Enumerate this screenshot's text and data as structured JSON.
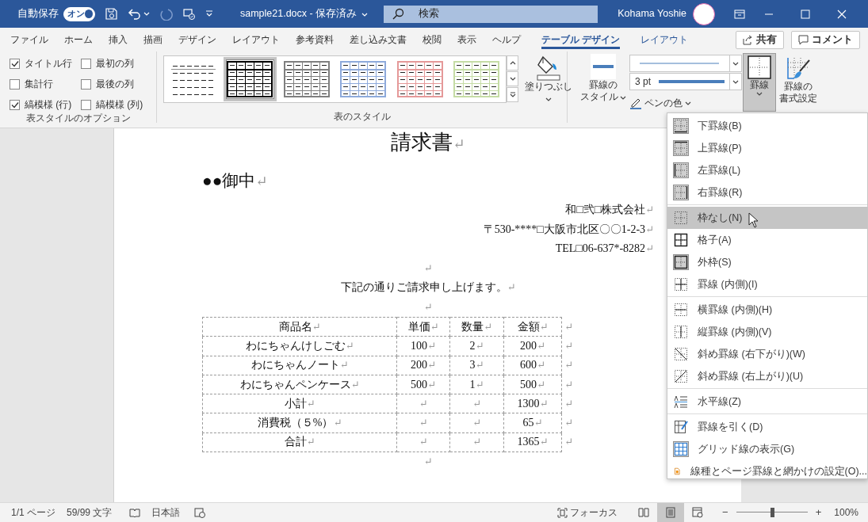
{
  "title_bar": {
    "autosave_label": "自動保存",
    "autosave_toggle": {
      "label": "オン",
      "on": true
    },
    "quick_access": [
      {
        "disabled": false
      },
      {
        "disabled": false
      },
      {
        "disabled": true
      },
      {
        "disabled": false
      }
    ],
    "document_title": "sample21.docx - 保存済み",
    "search": {
      "placeholder": "検索"
    },
    "user_name": "Kohama Yoshie"
  },
  "tabs": [
    {
      "label": "ファイル",
      "selected": false,
      "kind": "standard"
    },
    {
      "label": "ホーム",
      "selected": false,
      "kind": "standard"
    },
    {
      "label": "挿入",
      "selected": false,
      "kind": "standard"
    },
    {
      "label": "描画",
      "selected": false,
      "kind": "standard"
    },
    {
      "label": "デザイン",
      "selected": false,
      "kind": "standard"
    },
    {
      "label": "レイアウト",
      "selected": false,
      "kind": "standard"
    },
    {
      "label": "参考資料",
      "selected": false,
      "kind": "standard"
    },
    {
      "label": "差し込み文書",
      "selected": false,
      "kind": "standard"
    },
    {
      "label": "校閲",
      "selected": false,
      "kind": "standard"
    },
    {
      "label": "表示",
      "selected": false,
      "kind": "standard"
    },
    {
      "label": "ヘルプ",
      "selected": false,
      "kind": "standard"
    },
    {
      "label": "テーブル デザイン",
      "selected": true,
      "kind": "contextual"
    },
    {
      "label": "レイアウト",
      "selected": false,
      "kind": "contextual"
    }
  ],
  "share_button": "共有",
  "comment_button": "コメント",
  "table_style_options": {
    "label": "表スタイルのオプション",
    "checkboxes": [
      {
        "label": "タイトル行",
        "checked": true
      },
      {
        "label": "最初の列",
        "checked": false
      },
      {
        "label": "集計行",
        "checked": false
      },
      {
        "label": "最後の列",
        "checked": false
      },
      {
        "label": "縞模様 (行)",
        "checked": true
      },
      {
        "label": "縞模様 (列)",
        "checked": false
      }
    ]
  },
  "table_styles": {
    "label": "表のスタイル",
    "styles": [
      {
        "kind": "plain",
        "color": "#8c8c8c",
        "selected": false
      },
      {
        "kind": "grid",
        "color": "#000000",
        "selected": true
      },
      {
        "kind": "grid",
        "color": "#7f7f7f",
        "selected": false
      },
      {
        "kind": "grid",
        "color": "#8eaadb",
        "selected": false
      },
      {
        "kind": "grid",
        "color": "#e59999",
        "selected": false
      },
      {
        "kind": "grid",
        "color": "#c5dca5",
        "selected": false
      }
    ],
    "shading_button": "塗りつぶし"
  },
  "borders": {
    "style_button": [
      "罫線の",
      "スタイル"
    ],
    "line_weight": "3 pt",
    "pen_color_button": "ペンの色",
    "borders_button": {
      "label": "罫線",
      "selected": true
    },
    "border_painter_button": [
      "罫線の",
      "書式設定"
    ]
  },
  "document": {
    "paragraphs": [
      {
        "kind": "title",
        "text": "請求書",
        "mark": "↵"
      },
      {
        "kind": "addressee",
        "text": "●●御中",
        "mark": "↵"
      },
      {
        "kind": "sender",
        "text": "和□弐□株式会社",
        "mark": "↵"
      },
      {
        "kind": "sender",
        "text": "〒530-****□大阪市北区〇〇1-2-3",
        "mark": "↵"
      },
      {
        "kind": "sender",
        "text": "TEL□06-637*-8282",
        "mark": "↵"
      },
      {
        "kind": "blank",
        "mark": "↵"
      },
      {
        "kind": "body",
        "text": "下記の通りご請求申し上げます。",
        "mark": "↵"
      },
      {
        "kind": "blank",
        "mark": "↵"
      }
    ],
    "table": {
      "rows": [
        {
          "cells": [
            {
              "text": "商品名",
              "mark": "↵"
            },
            {
              "text": "単価",
              "mark": "↵"
            },
            {
              "text": "数量",
              "mark": "↵"
            },
            {
              "text": "金額",
              "mark": "↵"
            }
          ],
          "end_mark": "↵"
        },
        {
          "cells": [
            {
              "text": "わにちゃんけしごむ",
              "mark": "↵"
            },
            {
              "text": "100",
              "mark": "↵"
            },
            {
              "text": "2",
              "mark": "↵"
            },
            {
              "text": "200",
              "mark": "↵"
            }
          ],
          "end_mark": "↵"
        },
        {
          "cells": [
            {
              "text": "わにちゃんノート",
              "mark": "↵"
            },
            {
              "text": "200",
              "mark": "↵"
            },
            {
              "text": "3",
              "mark": "↵"
            },
            {
              "text": "600",
              "mark": "↵"
            }
          ],
          "end_mark": "↵"
        },
        {
          "cells": [
            {
              "text": "わにちゃんペンケース",
              "mark": "↵"
            },
            {
              "text": "500",
              "mark": "↵"
            },
            {
              "text": "1",
              "mark": "↵"
            },
            {
              "text": "500",
              "mark": "↵"
            }
          ],
          "end_mark": "↵"
        },
        {
          "cells": [
            {
              "text": "小計",
              "mark": "↵"
            },
            {
              "mark": "↵"
            },
            {
              "mark": "↵"
            },
            {
              "text": "1300",
              "mark": "↵"
            }
          ],
          "end_mark": "↵"
        },
        {
          "cells": [
            {
              "text": "消費税（５%）",
              "mark": "↵"
            },
            {
              "mark": "↵"
            },
            {
              "mark": "↵"
            },
            {
              "text": "65",
              "mark": "↵"
            }
          ],
          "end_mark": "↵"
        },
        {
          "cells": [
            {
              "text": "合計",
              "mark": "↵"
            },
            {
              "mark": "↵"
            },
            {
              "mark": "↵"
            },
            {
              "text": "1365",
              "mark": "↵"
            }
          ],
          "end_mark": "↵"
        }
      ]
    },
    "paragraphs_after": [
      {
        "kind": "blank",
        "mark": "↵"
      }
    ]
  },
  "borders_menu": {
    "groups": [
      [
        {
          "label": "下罫線(B)",
          "checked": true,
          "selected": false
        },
        {
          "label": "上罫線(P)",
          "checked": true,
          "selected": false
        },
        {
          "label": "左罫線(L)",
          "checked": true,
          "selected": false
        },
        {
          "label": "右罫線(R)",
          "checked": true,
          "selected": false
        }
      ],
      [
        {
          "label": "枠なし(N)",
          "checked": false,
          "selected": true
        },
        {
          "label": "格子(A)",
          "checked": false,
          "selected": false
        },
        {
          "label": "外枠(S)",
          "checked": true,
          "selected": false
        },
        {
          "label": "罫線 (内側)(I)",
          "checked": false,
          "selected": false
        }
      ],
      [
        {
          "label": "横罫線 (内側)(H)",
          "checked": false,
          "selected": false
        },
        {
          "label": "縦罫線 (内側)(V)",
          "checked": false,
          "selected": false
        },
        {
          "label": "斜め罫線 (右下がり)(W)",
          "checked": false,
          "selected": false
        },
        {
          "label": "斜め罫線 (右上がり)(U)",
          "checked": false,
          "selected": false
        }
      ],
      [
        {
          "label": "水平線(Z)",
          "checked": false,
          "selected": false
        }
      ],
      [
        {
          "label": "罫線を引く(D)",
          "checked": false,
          "selected": false
        },
        {
          "label": "グリッド線の表示(G)",
          "checked": true,
          "selected": false
        },
        {
          "label": "線種とページ罫線と網かけの設定(O)...",
          "checked": false,
          "selected": false
        }
      ]
    ]
  },
  "status_bar": {
    "page": "1/1 ページ",
    "word_count": "59/99 文字",
    "language": "日本語",
    "focus_button": "フォーカス",
    "views": [
      {
        "selected": false
      },
      {
        "selected": true
      },
      {
        "selected": false
      }
    ],
    "zoom_out": "−",
    "zoom": {
      "level": 0.5
    },
    "zoom_in": "+",
    "zoom_percent": "100%"
  }
}
